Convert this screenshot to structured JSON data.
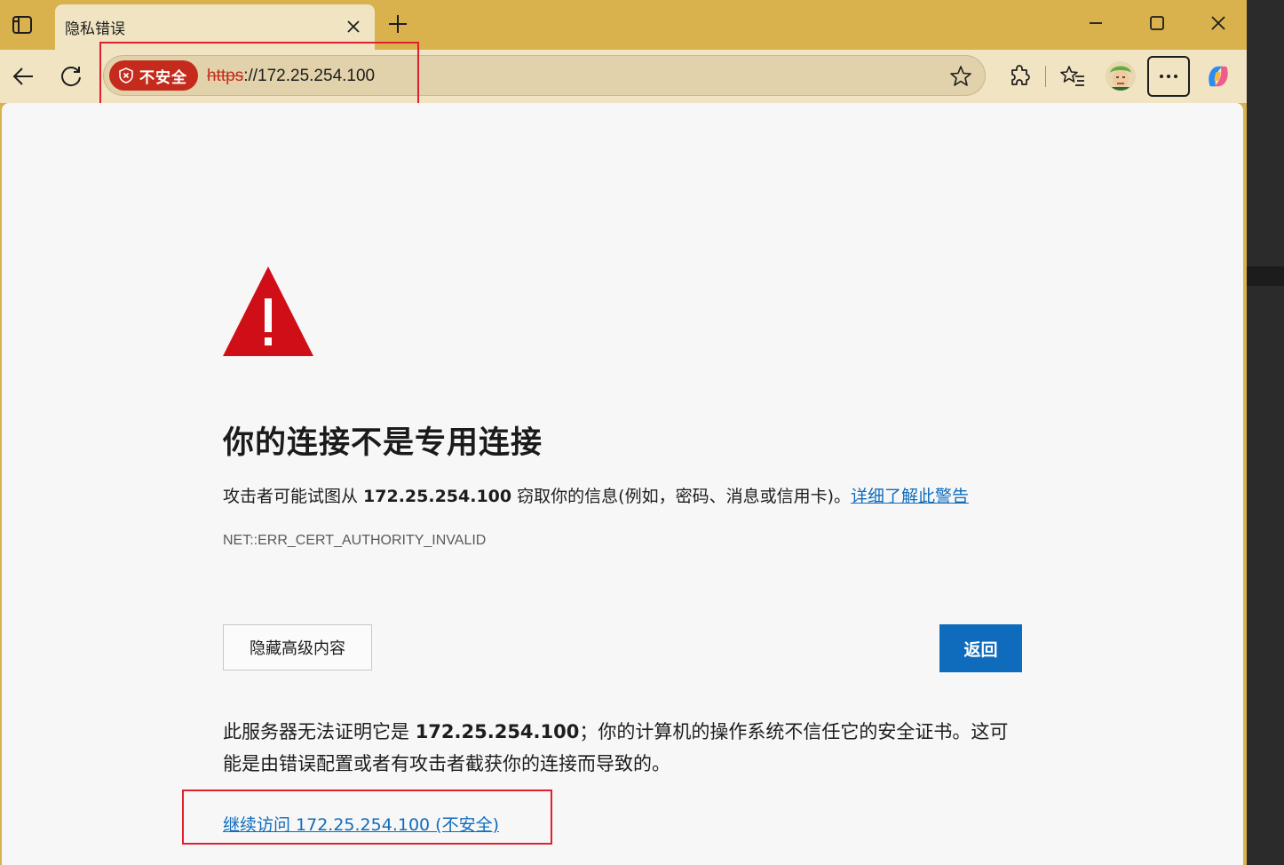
{
  "tab": {
    "title": "隐私错误"
  },
  "addressbar": {
    "security_label": "不安全",
    "url_scheme": "https",
    "url_rest": "://172.25.254.100"
  },
  "page": {
    "heading": "你的连接不是专用连接",
    "desc_prefix": "攻击者可能试图从 ",
    "host": "172.25.254.100",
    "desc_suffix": " 窃取你的信息(例如，密码、消息或信用卡)。",
    "learn_more_link": "详细了解此警告",
    "error_code": "NET::ERR_CERT_AUTHORITY_INVALID",
    "hide_advanced_button": "隐藏高级内容",
    "back_button": "返回",
    "explain_prefix": "此服务器无法证明它是 ",
    "explain_suffix": "；你的计算机的操作系统不信任它的安全证书。这可能是由错误配置或者有攻击者截获你的连接而导致的。",
    "proceed_link": "继续访问 172.25.254.100 (不安全)"
  },
  "colors": {
    "frame": "#d9b24e",
    "toolbar": "#f0e4c2",
    "danger": "#c42b1c",
    "link": "#0f6cbd",
    "annotation_box": "#e0202e"
  }
}
